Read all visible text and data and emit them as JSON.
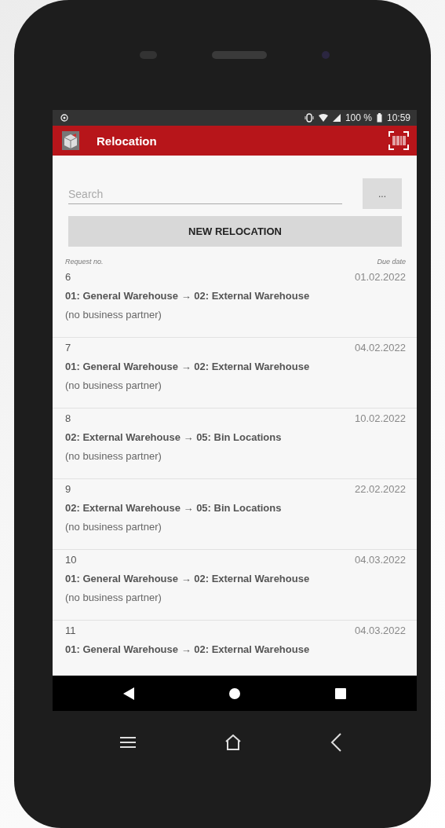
{
  "status_bar": {
    "time": "10:59",
    "battery": "100 %"
  },
  "app_bar": {
    "title": "Relocation"
  },
  "search": {
    "placeholder": "Search"
  },
  "more_button": {
    "label": "..."
  },
  "new_button": {
    "label": "NEW RELOCATION"
  },
  "list_header": {
    "left": "Request no.",
    "right": "Due date"
  },
  "requests": [
    {
      "number": "6",
      "due_date": "01.02.2022",
      "route": "01: General Warehouse → 02: External Warehouse",
      "partner": "(no business partner)"
    },
    {
      "number": "7",
      "due_date": "04.02.2022",
      "route": "01: General Warehouse → 02: External Warehouse",
      "partner": "(no business partner)"
    },
    {
      "number": "8",
      "due_date": "10.02.2022",
      "route": "02: External Warehouse → 05: Bin Locations",
      "partner": "(no business partner)"
    },
    {
      "number": "9",
      "due_date": "22.02.2022",
      "route": "02: External Warehouse → 05: Bin Locations",
      "partner": "(no business partner)"
    },
    {
      "number": "10",
      "due_date": "04.03.2022",
      "route": "01: General Warehouse → 02: External Warehouse",
      "partner": "(no business partner)"
    },
    {
      "number": "11",
      "due_date": "04.03.2022",
      "route": "01: General Warehouse → 02: External Warehouse"
    }
  ]
}
